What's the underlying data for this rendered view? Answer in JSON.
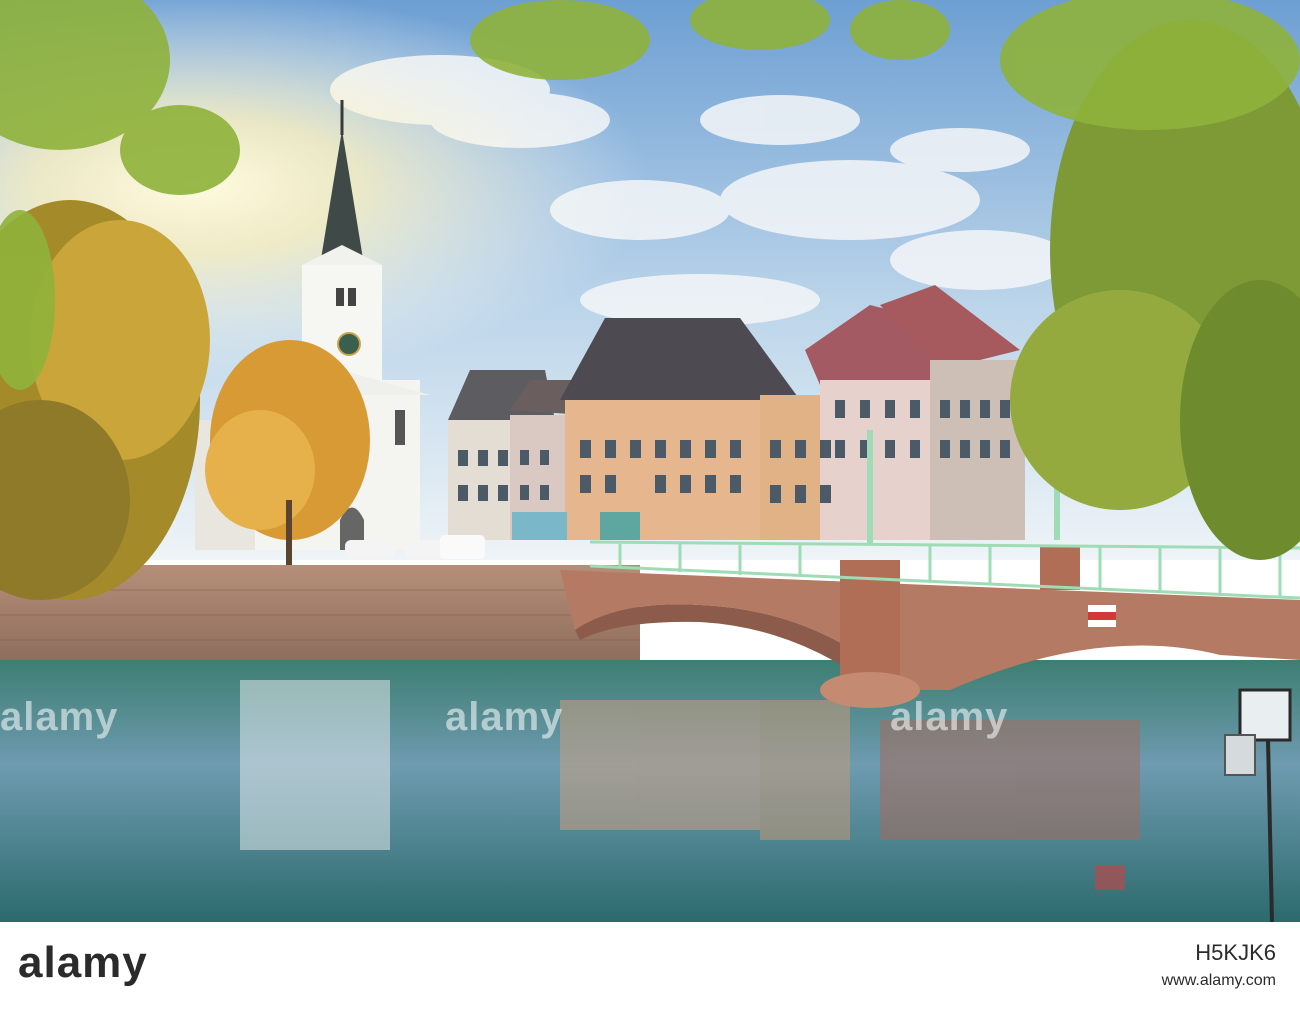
{
  "photo": {
    "subject": "church-bridge-river",
    "palette": {
      "sky_top": "#7fa9d6",
      "sky_bottom": "#e9f1f6",
      "water": "#2f6f6a",
      "bridge_stone": "#b9826a",
      "railing": "#9fdcb5",
      "foliage": "#8fb23b",
      "autumn": "#e0a235"
    }
  },
  "watermark": {
    "text": "alamy",
    "footer_logo": "alamy",
    "image_id": "H5KJK6",
    "url": "www.alamy.com"
  }
}
